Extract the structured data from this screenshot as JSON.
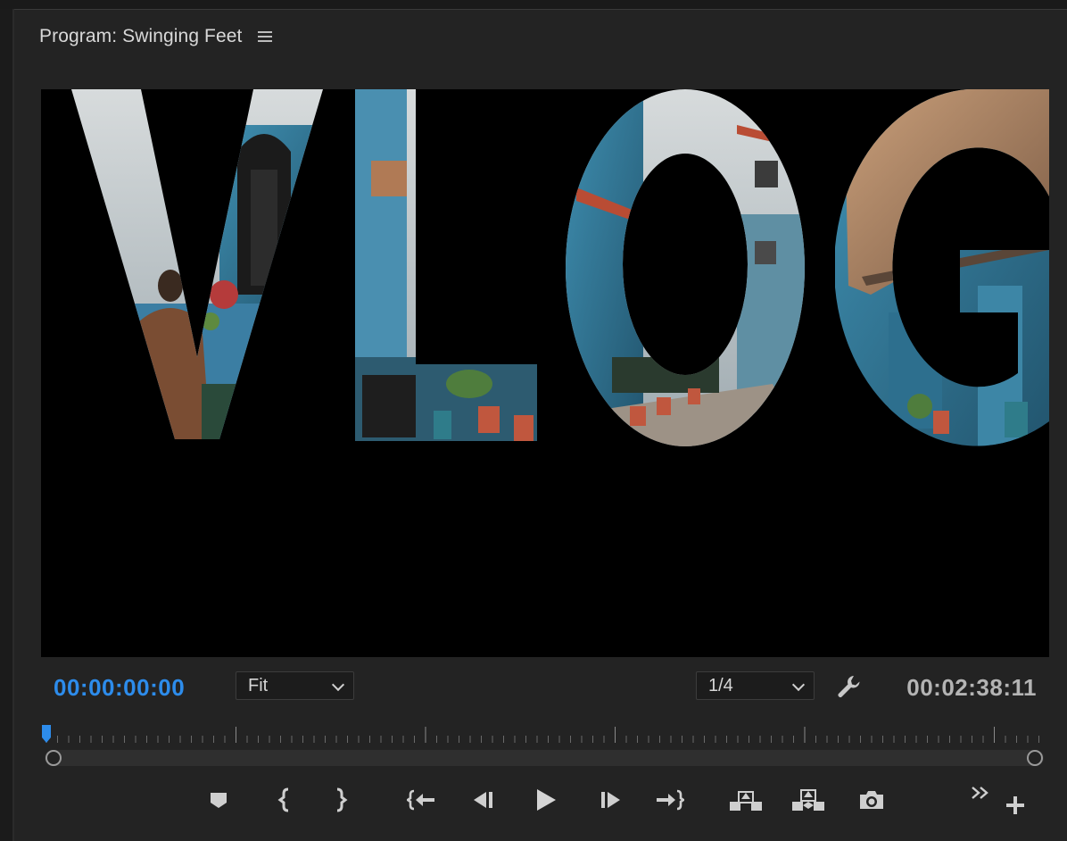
{
  "panel": {
    "title": "Program: Swinging Feet",
    "menu_icon": "hamburger-menu-icon"
  },
  "viewer": {
    "title_text": "VLOG",
    "description_visible": "video frame with VLOG letters revealing a blue-walled alley"
  },
  "controls": {
    "current_timecode": "00:00:00:00",
    "duration_timecode": "00:02:38:11",
    "zoom_select": {
      "value": "Fit"
    },
    "resolution_select": {
      "value": "1/4"
    },
    "settings_icon": "wrench-icon"
  },
  "colors": {
    "accent_blue": "#2d8ceb",
    "panel_bg": "#232323",
    "viewer_bg": "#000000"
  },
  "playhead": {
    "position": 0
  },
  "transport": {
    "buttons": [
      {
        "name": "add-marker-button",
        "icon": "marker-icon"
      },
      {
        "name": "mark-in-button",
        "icon": "mark-in-icon"
      },
      {
        "name": "mark-out-button",
        "icon": "mark-out-icon"
      },
      {
        "name": "go-to-in-button",
        "icon": "go-to-in-icon"
      },
      {
        "name": "step-back-button",
        "icon": "step-back-icon"
      },
      {
        "name": "play-button",
        "icon": "play-icon"
      },
      {
        "name": "step-forward-button",
        "icon": "step-forward-icon"
      },
      {
        "name": "go-to-out-button",
        "icon": "go-to-out-icon"
      },
      {
        "name": "lift-button",
        "icon": "lift-icon"
      },
      {
        "name": "extract-button",
        "icon": "extract-icon"
      },
      {
        "name": "export-frame-button",
        "icon": "camera-icon"
      },
      {
        "name": "more-controls-button",
        "icon": "double-chevron-icon"
      },
      {
        "name": "button-editor-button",
        "icon": "plus-icon"
      }
    ]
  }
}
